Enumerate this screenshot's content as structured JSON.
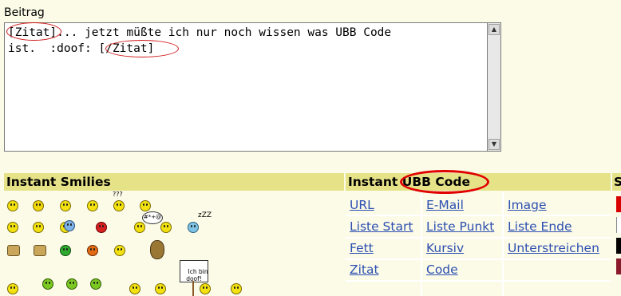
{
  "beitrag": {
    "label": "Beitrag",
    "text": "[Zitat]... jetzt müßte ich nur noch wissen was UBB Code\nist.  :doof: [/Zitat]"
  },
  "smilies": {
    "heading": "Instant Smilies",
    "sign_text": "Ich bin\ndoof!",
    "speech_text": "#*+@",
    "sleep_text": "zZZ",
    "question_text": "???"
  },
  "ubb": {
    "heading_prefix": "Instant ",
    "heading_highlight": "UBB Code",
    "rows": [
      [
        "URL",
        "E-Mail",
        "Image"
      ],
      [
        "Liste Start",
        "Liste Punkt",
        "Liste Ende"
      ],
      [
        "Fett",
        "Kursiv",
        "Unterstreichen"
      ],
      [
        "Zitat",
        "Code",
        ""
      ]
    ]
  },
  "colors_panel": {
    "heading": "S",
    "swatches": [
      "#d90000",
      "#ffffff",
      "#000000",
      "#8b1a2b"
    ]
  },
  "colors": {
    "header_bg": "#e6e288",
    "link": "#2d4fb0",
    "highlight_ring": "#e00000"
  }
}
